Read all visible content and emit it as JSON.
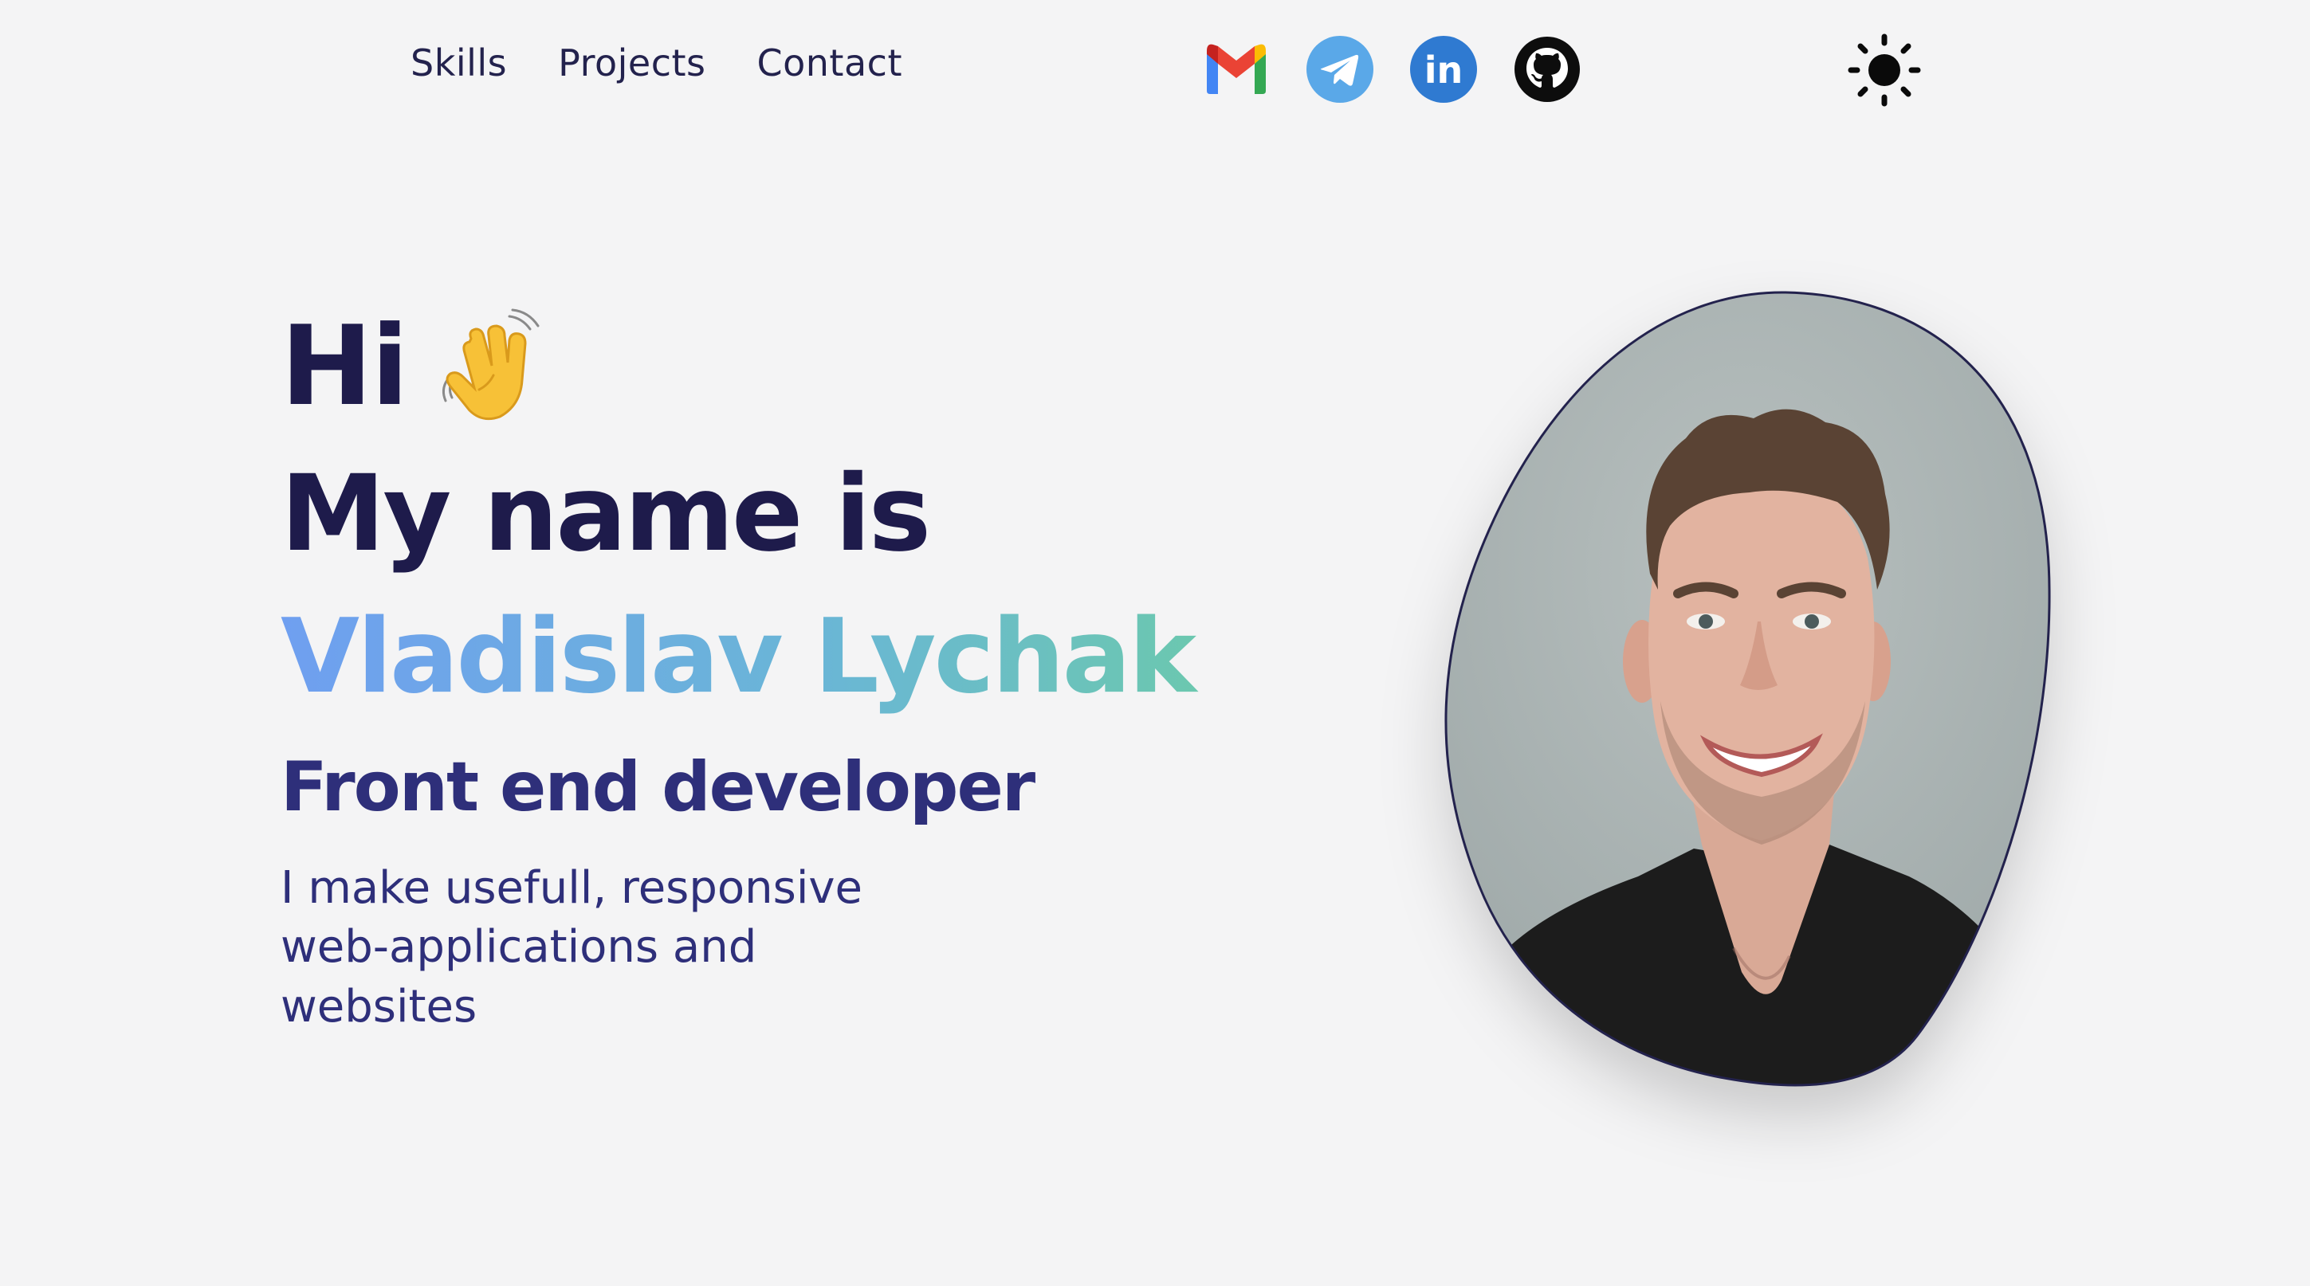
{
  "nav": {
    "items": [
      {
        "label": "Skills"
      },
      {
        "label": "Projects"
      },
      {
        "label": "Contact"
      }
    ]
  },
  "social": {
    "icons": [
      "gmail-icon",
      "telegram-icon",
      "linkedin-icon",
      "github-icon"
    ],
    "linkedin_text": "in"
  },
  "theme": {
    "icon": "sun-icon"
  },
  "hero": {
    "greeting": "Hi",
    "greeting_icon": "waving-hand-icon",
    "intro": "My name is",
    "name": "Vladislav Lychak",
    "role": "Front end developer",
    "tagline": "I make usefull, responsive web-applications and websites"
  },
  "colors": {
    "background": "#f4f4f5",
    "heading": "#1e1b4b",
    "accent": "#2e2f7a",
    "gradient_start": "#6f9ff0",
    "gradient_end": "#6ccf9f"
  }
}
